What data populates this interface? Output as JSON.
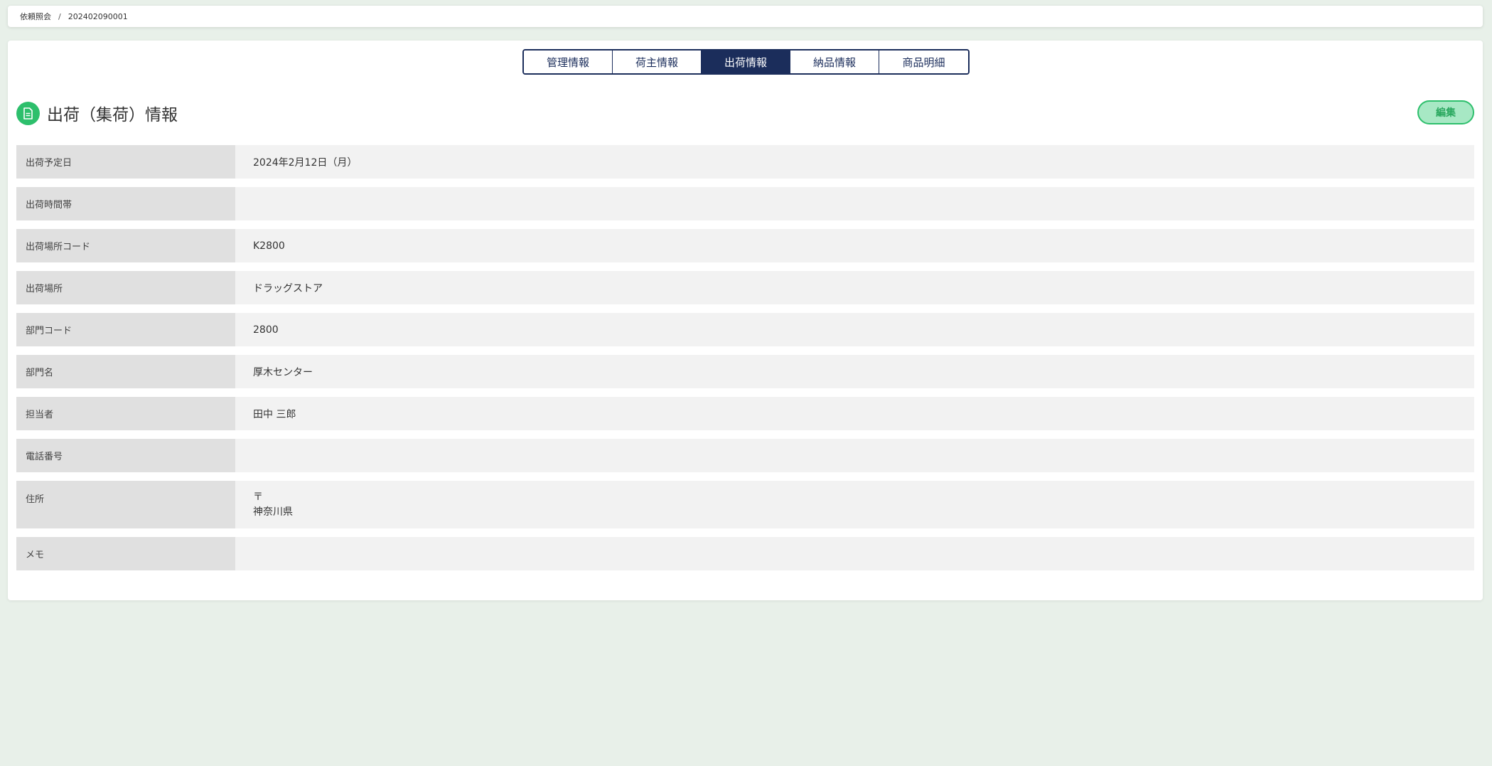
{
  "breadcrumb": {
    "parent": "依頼照会",
    "separator": "/",
    "current": "202402090001"
  },
  "tabs": [
    {
      "label": "管理情報",
      "active": false
    },
    {
      "label": "荷主情報",
      "active": false
    },
    {
      "label": "出荷情報",
      "active": true
    },
    {
      "label": "納品情報",
      "active": false
    },
    {
      "label": "商品明細",
      "active": false
    }
  ],
  "section": {
    "title": "出荷（集荷）情報",
    "icon": "document-icon",
    "edit_label": "編集"
  },
  "fields": [
    {
      "label": "出荷予定日",
      "value": "2024年2月12日（月）"
    },
    {
      "label": "出荷時間帯",
      "value": ""
    },
    {
      "label": "出荷場所コード",
      "value": "K2800"
    },
    {
      "label": "出荷場所",
      "value": "ドラッグストア"
    },
    {
      "label": "部門コード",
      "value": "2800"
    },
    {
      "label": "部門名",
      "value": "厚木センター"
    },
    {
      "label": "担当者",
      "value": "田中 三郎"
    },
    {
      "label": "電話番号",
      "value": ""
    },
    {
      "label": "住所",
      "postal_mark": "〒",
      "prefecture": "神奈川県"
    },
    {
      "label": "メモ",
      "value": ""
    }
  ],
  "colors": {
    "background": "#e8f0e9",
    "tab_active": "#1b2d5b",
    "accent_green": "#2dbf6c"
  }
}
